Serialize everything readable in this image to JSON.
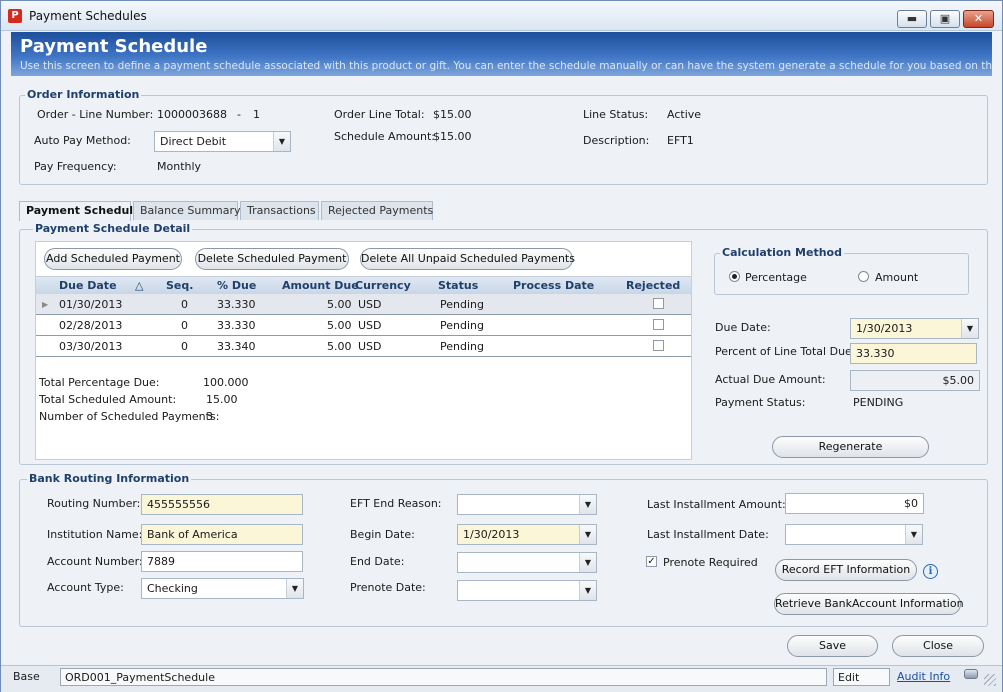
{
  "window": {
    "title": "Payment Schedules",
    "icon_letter": "P",
    "minimize": "▬",
    "maximize": "▣",
    "close": "✕"
  },
  "header": {
    "title": "Payment Schedule",
    "subtitle": "Use this screen to define a payment schedule associated with this product or gift. You can enter the schedule manually or can have the system generate a schedule for you based on the balanc"
  },
  "order_info": {
    "legend": "Order Information",
    "order_line_label": "Order - Line Number:",
    "order_number": "1000003688",
    "dash": "-",
    "line_number": "1",
    "auto_pay_label": "Auto Pay Method:",
    "auto_pay_value": "Direct Debit",
    "pay_freq_label": "Pay Frequency:",
    "pay_freq_value": "Monthly",
    "line_total_label": "Order Line Total:",
    "line_total_value": "$15.00",
    "schedule_amount_label": "Schedule Amount:",
    "schedule_amount_value": "$15.00",
    "line_status_label": "Line Status:",
    "line_status_value": "Active",
    "description_label": "Description:",
    "description_value": "EFT1"
  },
  "tabs": [
    {
      "label": "Payment Schedule"
    },
    {
      "label": "Balance Summary"
    },
    {
      "label": "Transactions"
    },
    {
      "label": "Rejected Payments"
    }
  ],
  "schedule_detail": {
    "legend": "Payment Schedule Detail",
    "buttons": {
      "add": "Add Scheduled Payment",
      "delete": "Delete Scheduled Payment",
      "delete_all": "Delete All Unpaid Scheduled Payments"
    },
    "columns": [
      "Due Date",
      "Seq.",
      "% Due",
      "Amount Due",
      "Currency",
      "Status",
      "Process Date",
      "Rejected"
    ],
    "sort_indicator": "△",
    "rows": [
      {
        "due_date": "01/30/2013",
        "seq": "0",
        "pct_due": "33.330",
        "amount_due": "5.00",
        "currency": "USD",
        "status": "Pending",
        "process_date": "",
        "rejected": false
      },
      {
        "due_date": "02/28/2013",
        "seq": "0",
        "pct_due": "33.330",
        "amount_due": "5.00",
        "currency": "USD",
        "status": "Pending",
        "process_date": "",
        "rejected": false
      },
      {
        "due_date": "03/30/2013",
        "seq": "0",
        "pct_due": "33.340",
        "amount_due": "5.00",
        "currency": "USD",
        "status": "Pending",
        "process_date": "",
        "rejected": false
      }
    ],
    "totals": {
      "total_pct_label": "Total Percentage Due:",
      "total_pct_value": "100.000",
      "total_amount_label": "Total Scheduled Amount:",
      "total_amount_value": "15.00",
      "num_payments_label": "Number of Scheduled Payments:",
      "num_payments_value": "3"
    }
  },
  "calculation": {
    "legend": "Calculation Method",
    "percentage_label": "Percentage",
    "amount_label": "Amount",
    "selected": "Percentage"
  },
  "detail_fields": {
    "due_date_label": "Due Date:",
    "due_date_value": "1/30/2013",
    "percent_label": "Percent of Line Total Due:",
    "percent_value": "33.330",
    "actual_due_label": "Actual Due Amount:",
    "actual_due_value": "$5.00",
    "payment_status_label": "Payment Status:",
    "payment_status_value": "PENDING",
    "regenerate": "Regenerate"
  },
  "bank": {
    "legend": "Bank Routing Information",
    "routing_label": "Routing Number:",
    "routing_value": "455555556",
    "institution_label": "Institution Name:",
    "institution_value": "Bank of America",
    "account_number_label": "Account Number:",
    "account_number_value": "7889",
    "account_type_label": "Account Type:",
    "account_type_value": "Checking",
    "eft_end_label": "EFT End Reason:",
    "eft_end_value": "",
    "begin_date_label": "Begin Date:",
    "begin_date_value": "1/30/2013",
    "end_date_label": "End Date:",
    "end_date_value": "",
    "prenote_date_label": "Prenote Date:",
    "prenote_date_value": "",
    "last_amount_label": "Last Installment Amount:",
    "last_amount_value": "$0",
    "last_date_label": "Last Installment Date:",
    "last_date_value": "",
    "prenote_required_label": "Prenote Required",
    "prenote_required": true,
    "record_eft": "Record EFT Information",
    "retrieve_bank": "Retrieve BankAccount Information"
  },
  "actions": {
    "save": "Save",
    "close": "Close"
  },
  "status_bar": {
    "mode": "Base",
    "screen": "ORD001_PaymentSchedule",
    "edit": "Edit",
    "audit": "Audit Info"
  },
  "colors": {
    "header": "#2d63b3",
    "required": "#fbf6d8",
    "legend": "#1f3f6c"
  }
}
